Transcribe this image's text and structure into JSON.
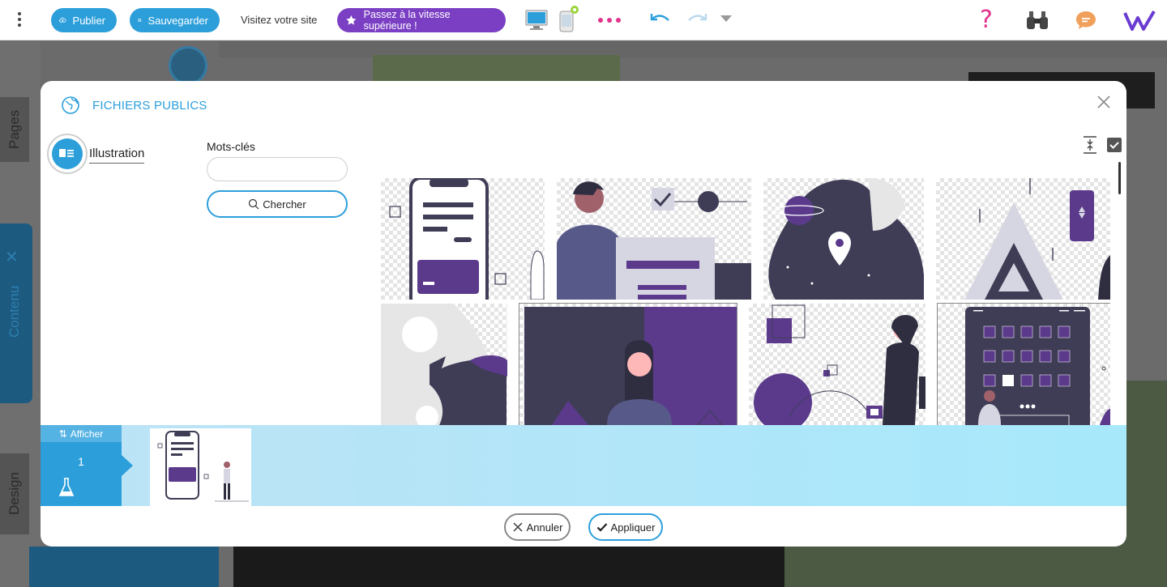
{
  "toolbar": {
    "publish_label": "Publier",
    "save_label": "Sauvegarder",
    "visit_label": "Visitez votre site",
    "upgrade_label": "Passez à la vitesse supérieure !",
    "help_label": "?",
    "icons": [
      "more-vertical-icon",
      "cloud-upload-icon",
      "floppy-icon",
      "star-icon",
      "desktop-icon",
      "mobile-icon",
      "more-horizontal-icon",
      "undo-icon",
      "redo-icon",
      "caret-down-icon",
      "help-icon",
      "binoculars-icon",
      "chat-icon",
      "logo-icon"
    ]
  },
  "background": {
    "tabs": [
      "Pages",
      "Contenu",
      "Design"
    ]
  },
  "modal": {
    "title": "FICHIERS PUBLICS",
    "category_label": "Illustration",
    "keywords_label": "Mots-clés",
    "keywords_value": "",
    "search_label": "Chercher",
    "strip_header": "Afficher",
    "strip_number": "1",
    "cancel_label": "Annuler",
    "apply_label": "Appliquer"
  },
  "colors": {
    "accent": "#2c9fdb",
    "upgrade": "#7b3fc4",
    "illustration_dark": "#3f3d56",
    "illustration_purple": "#5b3a8c",
    "pink": "#e0338c"
  }
}
